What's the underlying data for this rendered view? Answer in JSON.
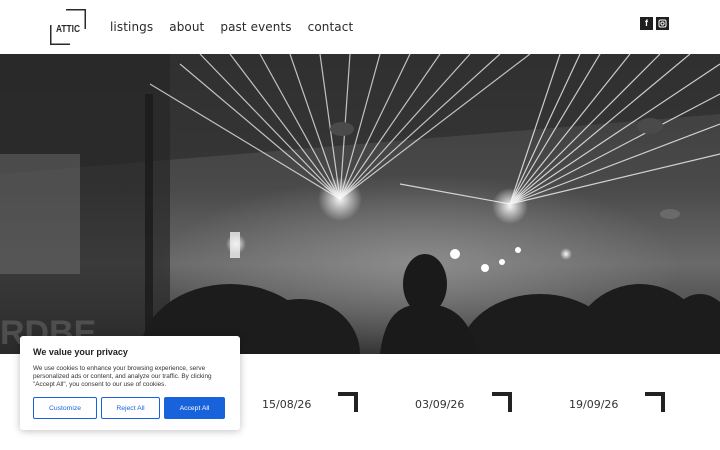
{
  "header": {
    "logo_text": "ATTIC",
    "nav": [
      {
        "label": "listings"
      },
      {
        "label": "about"
      },
      {
        "label": "past events"
      },
      {
        "label": "contact"
      }
    ],
    "social": [
      {
        "icon": "facebook-icon",
        "glyph": "f"
      },
      {
        "icon": "instagram-icon"
      }
    ]
  },
  "hero": {
    "icon": "club-laser-photo"
  },
  "events": [
    {
      "date": "15/08/26"
    },
    {
      "date": "03/09/26"
    },
    {
      "date": "19/09/26"
    }
  ],
  "cookie": {
    "title": "We value your privacy",
    "text": "We use cookies to enhance your browsing experience, serve personalized ads or content, and analyze our traffic. By clicking \"Accept All\", you consent to our use of cookies.",
    "customize_label": "Customize",
    "reject_label": "Reject All",
    "accept_label": "Accept All",
    "accent_color": "#1863dc"
  }
}
